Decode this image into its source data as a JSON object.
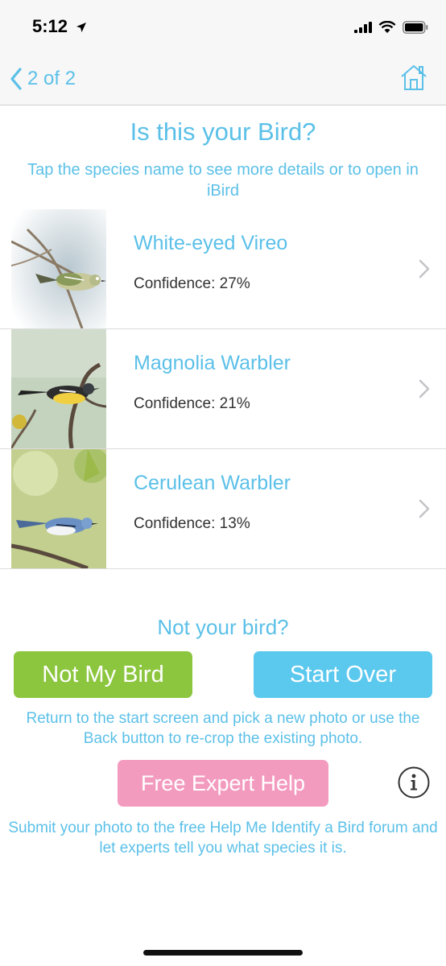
{
  "status_bar": {
    "time": "5:12"
  },
  "nav": {
    "back_label": "2 of 2"
  },
  "header": {
    "title": "Is this your Bird?",
    "subtitle": "Tap the species name to see more details or to open in iBird"
  },
  "results": [
    {
      "name": "White-eyed Vireo",
      "confidence": "Confidence: 27%"
    },
    {
      "name": "Magnolia Warbler",
      "confidence": "Confidence: 21%"
    },
    {
      "name": "Cerulean Warbler",
      "confidence": "Confidence: 13%"
    }
  ],
  "actions": {
    "not_heading": "Not your bird?",
    "not_my_bird_label": "Not My Bird",
    "start_over_label": "Start Over",
    "return_text": "Return to the start screen and pick a new photo or use the Back button to re-crop the existing photo.",
    "expert_label": "Free Expert Help",
    "expert_text": "Submit your photo to the free Help Me Identify a Bird forum and let experts tell you what species it is."
  },
  "colors": {
    "accent": "#5bc0e8",
    "green_button": "#8cc63f",
    "blue_button": "#5bc8ee",
    "pink_button": "#f39bbf"
  },
  "icons": [
    "location-arrow-icon",
    "signal-icon",
    "wifi-icon",
    "battery-icon",
    "back-chevron-icon",
    "home-icon",
    "chevron-right-icon",
    "info-icon"
  ]
}
